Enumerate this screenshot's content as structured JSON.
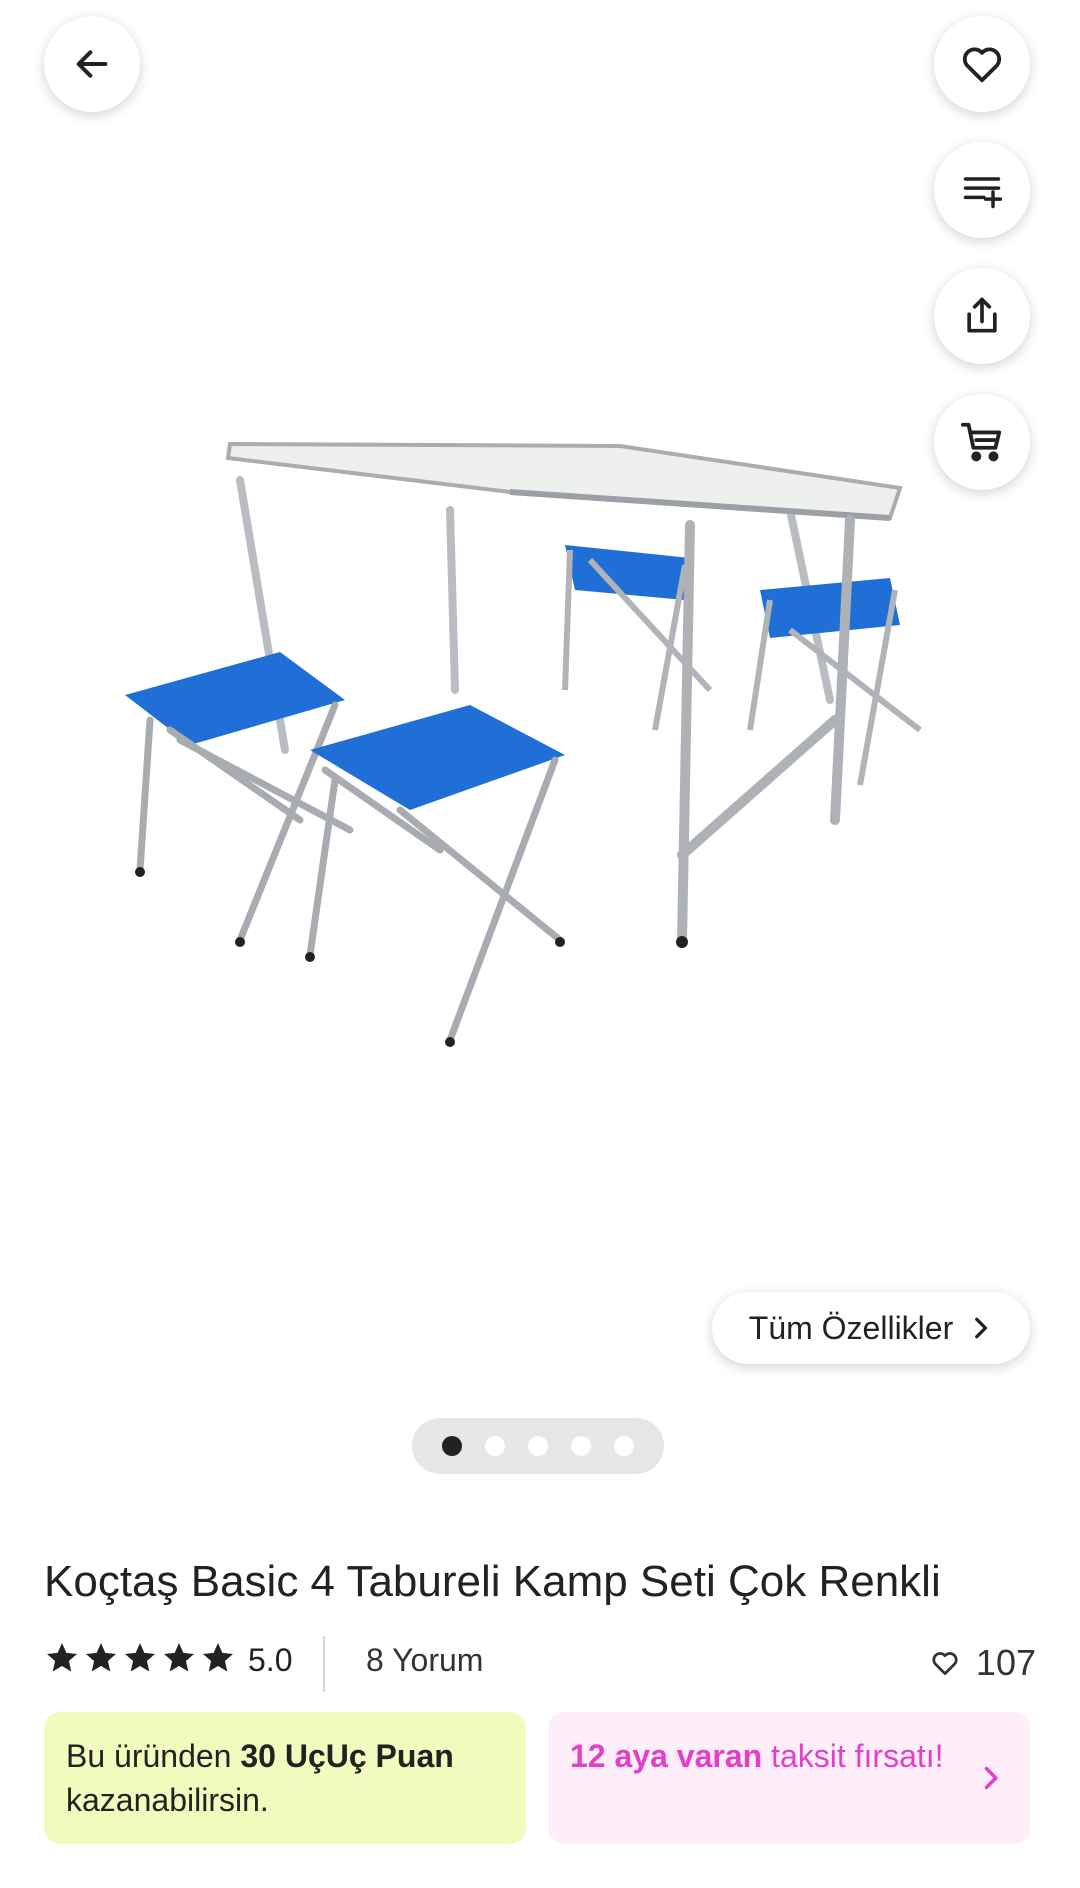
{
  "product": {
    "title": "Koçtaş Basic 4 Tabureli Kamp Seti Çok Renkli",
    "rating": "5.0",
    "reviews": "8 Yorum",
    "favorites": "107",
    "image_index": 1,
    "image_count": 5
  },
  "buttons": {
    "all_specs": "Tüm Özellikler"
  },
  "icons": {
    "back": "arrow-left-icon",
    "favorite": "heart-icon",
    "add_to_list": "add-to-list-icon",
    "share": "share-icon",
    "cart": "cart-icon",
    "chevron": "chevron-right-icon",
    "star": "star-icon"
  },
  "promos": {
    "points": {
      "prefix": "Bu üründen ",
      "bold": "30 UçUç Puan",
      "suffix": "kazanabilirsin."
    },
    "installment": {
      "bold": "12 aya varan",
      "text": " taksit fırsatı!"
    }
  },
  "colors": {
    "accent_pink": "#e23fcb",
    "points_bg": "#f2fbbd",
    "installment_bg": "#fdeefa",
    "star": "#222222"
  }
}
